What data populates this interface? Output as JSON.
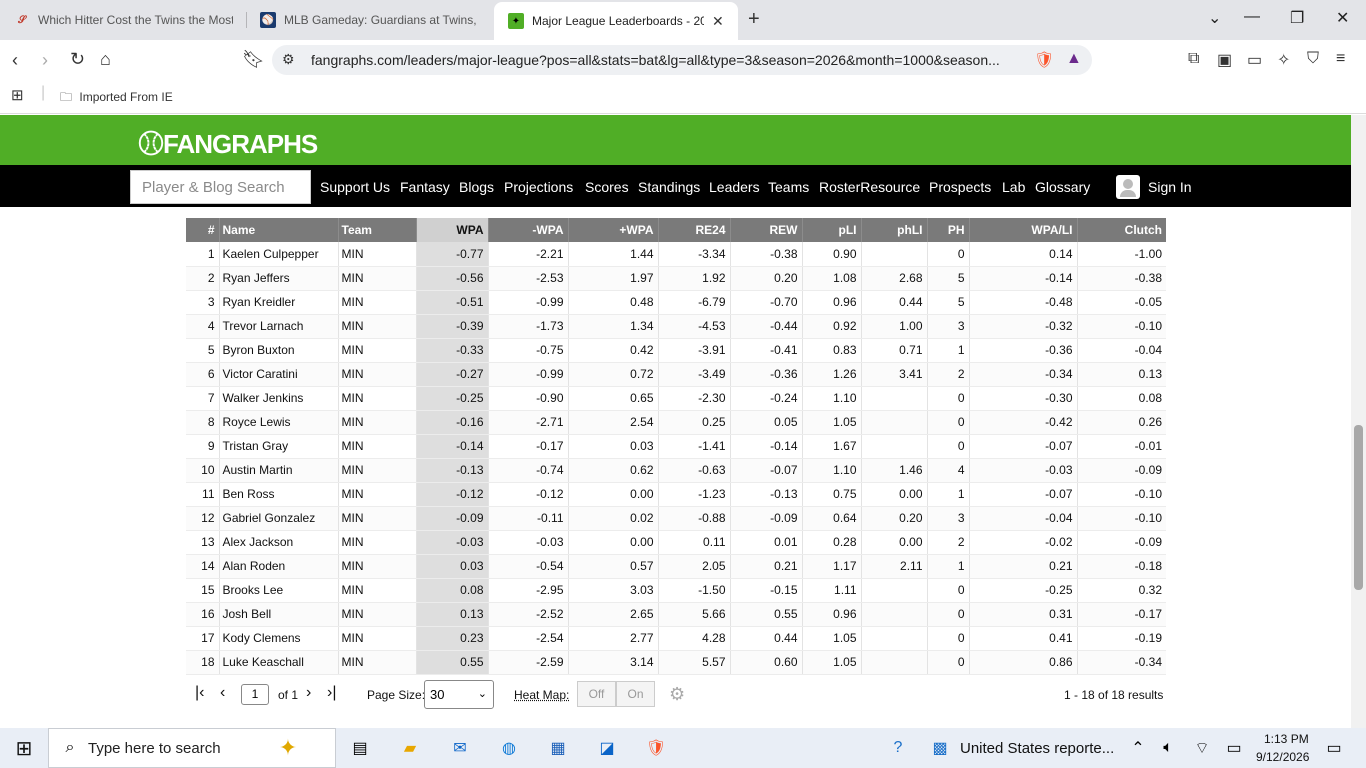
{
  "browser": {
    "tabs": [
      {
        "title": "Which Hitter Cost the Twins the Most",
        "active": false
      },
      {
        "title": "MLB Gameday: Guardians at Twins, P",
        "active": false
      },
      {
        "title": "Major League Leaderboards - 20",
        "active": true
      }
    ],
    "url": "fangraphs.com/leaders/major-league?pos=all&stats=bat&lg=all&type=3&season=2026&month=1000&season...",
    "bookmark_folder": "Imported From IE",
    "extension_badge": "3"
  },
  "site": {
    "logo": "FANGRAPHS",
    "search_placeholder": "Player & Blog Search",
    "nav": [
      "Support Us",
      "Fantasy",
      "Blogs",
      "Projections",
      "Scores",
      "Standings",
      "Leaders",
      "Teams",
      "RosterResource",
      "Prospects",
      "Lab",
      "Glossary"
    ],
    "sign_in": "Sign In"
  },
  "table": {
    "headers": [
      "#",
      "Name",
      "Team",
      "WPA",
      "-WPA",
      "+WPA",
      "RE24",
      "REW",
      "pLI",
      "phLI",
      "PH",
      "WPA/LI",
      "Clutch"
    ],
    "sorted_column": "WPA",
    "rows": [
      [
        "1",
        "Kaelen Culpepper",
        "MIN",
        "-0.77",
        "-2.21",
        "1.44",
        "-3.34",
        "-0.38",
        "0.90",
        "",
        "0",
        "0.14",
        "-1.00"
      ],
      [
        "2",
        "Ryan Jeffers",
        "MIN",
        "-0.56",
        "-2.53",
        "1.97",
        "1.92",
        "0.20",
        "1.08",
        "2.68",
        "5",
        "-0.14",
        "-0.38"
      ],
      [
        "3",
        "Ryan Kreidler",
        "MIN",
        "-0.51",
        "-0.99",
        "0.48",
        "-6.79",
        "-0.70",
        "0.96",
        "0.44",
        "5",
        "-0.48",
        "-0.05"
      ],
      [
        "4",
        "Trevor Larnach",
        "MIN",
        "-0.39",
        "-1.73",
        "1.34",
        "-4.53",
        "-0.44",
        "0.92",
        "1.00",
        "3",
        "-0.32",
        "-0.10"
      ],
      [
        "5",
        "Byron Buxton",
        "MIN",
        "-0.33",
        "-0.75",
        "0.42",
        "-3.91",
        "-0.41",
        "0.83",
        "0.71",
        "1",
        "-0.36",
        "-0.04"
      ],
      [
        "6",
        "Victor Caratini",
        "MIN",
        "-0.27",
        "-0.99",
        "0.72",
        "-3.49",
        "-0.36",
        "1.26",
        "3.41",
        "2",
        "-0.34",
        "0.13"
      ],
      [
        "7",
        "Walker Jenkins",
        "MIN",
        "-0.25",
        "-0.90",
        "0.65",
        "-2.30",
        "-0.24",
        "1.10",
        "",
        "0",
        "-0.30",
        "0.08"
      ],
      [
        "8",
        "Royce Lewis",
        "MIN",
        "-0.16",
        "-2.71",
        "2.54",
        "0.25",
        "0.05",
        "1.05",
        "",
        "0",
        "-0.42",
        "0.26"
      ],
      [
        "9",
        "Tristan Gray",
        "MIN",
        "-0.14",
        "-0.17",
        "0.03",
        "-1.41",
        "-0.14",
        "1.67",
        "",
        "0",
        "-0.07",
        "-0.01"
      ],
      [
        "10",
        "Austin Martin",
        "MIN",
        "-0.13",
        "-0.74",
        "0.62",
        "-0.63",
        "-0.07",
        "1.10",
        "1.46",
        "4",
        "-0.03",
        "-0.09"
      ],
      [
        "11",
        "Ben Ross",
        "MIN",
        "-0.12",
        "-0.12",
        "0.00",
        "-1.23",
        "-0.13",
        "0.75",
        "0.00",
        "1",
        "-0.07",
        "-0.10"
      ],
      [
        "12",
        "Gabriel Gonzalez",
        "MIN",
        "-0.09",
        "-0.11",
        "0.02",
        "-0.88",
        "-0.09",
        "0.64",
        "0.20",
        "3",
        "-0.04",
        "-0.10"
      ],
      [
        "13",
        "Alex Jackson",
        "MIN",
        "-0.03",
        "-0.03",
        "0.00",
        "0.11",
        "0.01",
        "0.28",
        "0.00",
        "2",
        "-0.02",
        "-0.09"
      ],
      [
        "14",
        "Alan Roden",
        "MIN",
        "0.03",
        "-0.54",
        "0.57",
        "2.05",
        "0.21",
        "1.17",
        "2.11",
        "1",
        "0.21",
        "-0.18"
      ],
      [
        "15",
        "Brooks Lee",
        "MIN",
        "0.08",
        "-2.95",
        "3.03",
        "-1.50",
        "-0.15",
        "1.11",
        "",
        "0",
        "-0.25",
        "0.32"
      ],
      [
        "16",
        "Josh Bell",
        "MIN",
        "0.13",
        "-2.52",
        "2.65",
        "5.66",
        "0.55",
        "0.96",
        "",
        "0",
        "0.31",
        "-0.17"
      ],
      [
        "17",
        "Kody Clemens",
        "MIN",
        "0.23",
        "-2.54",
        "2.77",
        "4.28",
        "0.44",
        "1.05",
        "",
        "0",
        "0.41",
        "-0.19"
      ],
      [
        "18",
        "Luke Keaschall",
        "MIN",
        "0.55",
        "-2.59",
        "3.14",
        "5.57",
        "0.60",
        "1.05",
        "",
        "0",
        "0.86",
        "-0.34"
      ]
    ]
  },
  "pager": {
    "page": "1",
    "of_label": "of 1",
    "page_size_label": "Page Size:",
    "page_size": "30",
    "heatmap_label": "Heat Map:",
    "heatmap_off": "Off",
    "heatmap_on": "On",
    "results": "1 - 18 of 18 results"
  },
  "taskbar": {
    "search_placeholder": "Type here to search",
    "news": "United States reporte...",
    "time": "1:13 PM",
    "date": "9/12/2026"
  },
  "colors": {
    "fg_green": "#50ae26",
    "nav_black": "#000000",
    "header_gray": "#7a7a7a",
    "sorted_col": "#dedede"
  }
}
